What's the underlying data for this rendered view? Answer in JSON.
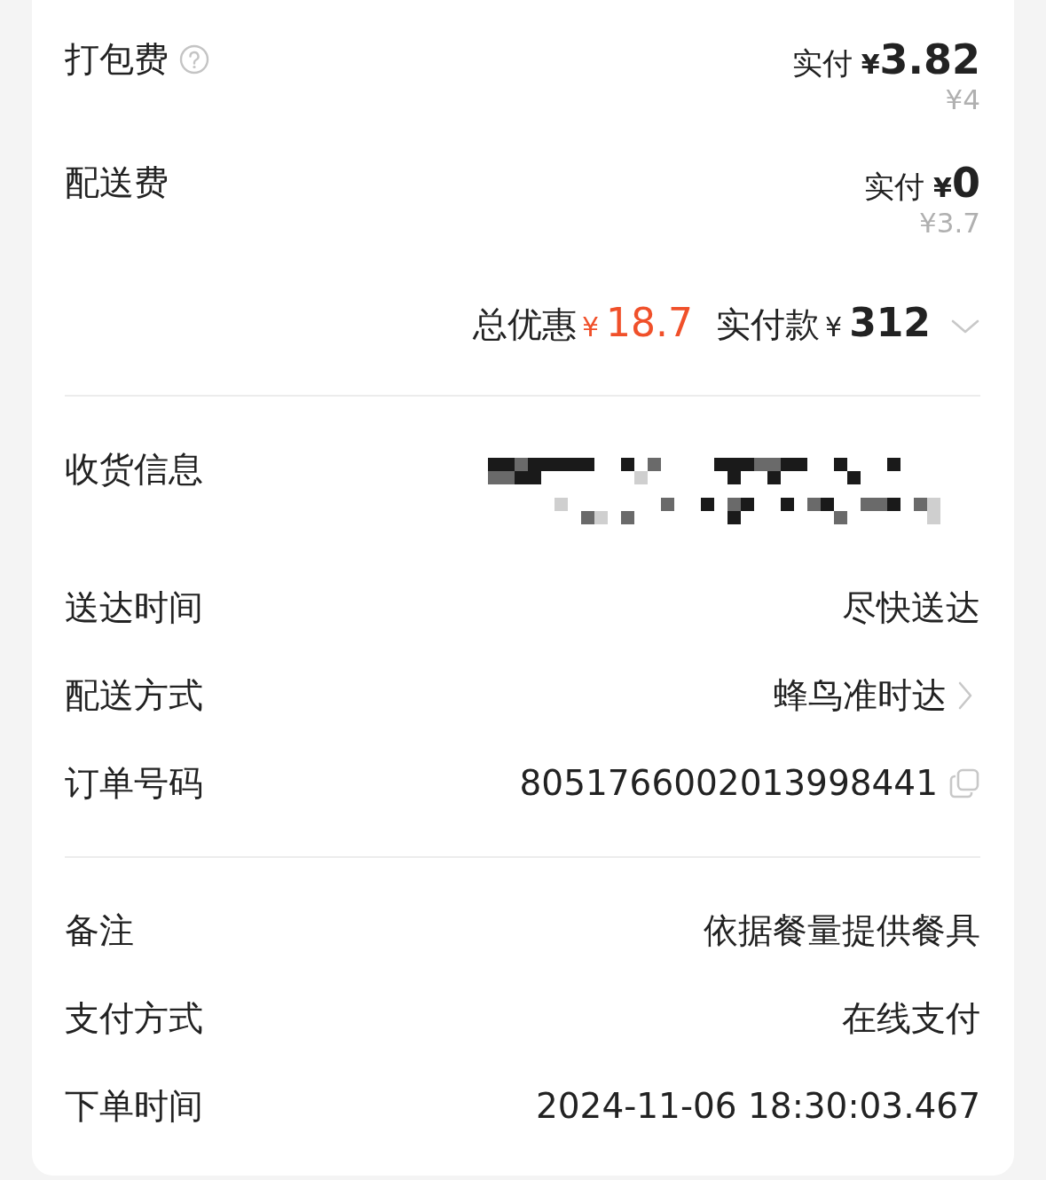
{
  "fees": [
    {
      "label": "打包费",
      "has_help": true,
      "paid_label": "实付",
      "currency": "¥",
      "amount": "3.82",
      "original": "¥4"
    },
    {
      "label": "配送费",
      "paid_label": "实付",
      "currency": "¥",
      "amount": "0",
      "original": "¥3.7"
    }
  ],
  "summary": {
    "discount_label": "总优惠",
    "discount_currency": "¥",
    "discount_amount": "18.7",
    "paid_label": "实付款",
    "paid_currency": "¥",
    "paid_amount": "312",
    "expanded": false
  },
  "sections": [
    {
      "rows": [
        {
          "kind": "redacted",
          "label": "收货信息"
        },
        {
          "kind": "text",
          "label": "送达时间",
          "value": "尽快送达"
        },
        {
          "kind": "link",
          "label": "配送方式",
          "value": "蜂鸟准时达"
        },
        {
          "kind": "copy",
          "label": "订单号码",
          "value": "8051766002013998441"
        }
      ]
    },
    {
      "rows": [
        {
          "kind": "text",
          "label": "备注",
          "value": "依据餐量提供餐具"
        },
        {
          "kind": "text",
          "label": "支付方式",
          "value": "在线支付"
        },
        {
          "kind": "text",
          "label": "下单时间",
          "value": "2024-11-06 18:30:03.467"
        }
      ]
    }
  ]
}
